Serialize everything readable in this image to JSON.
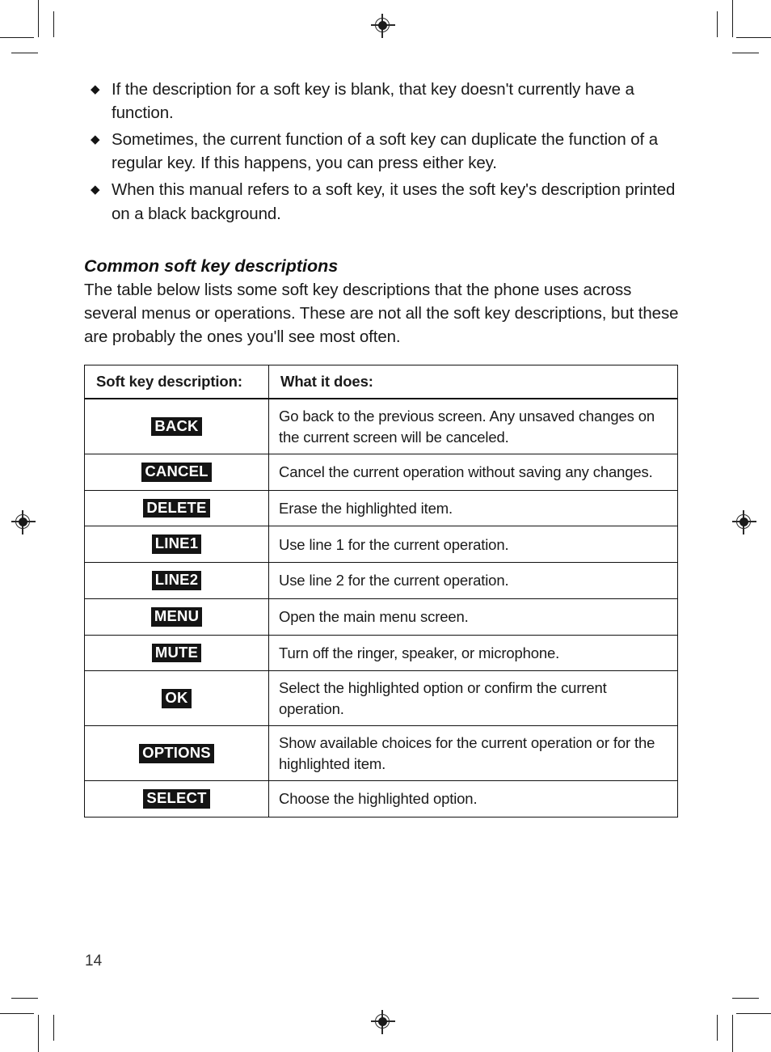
{
  "page": {
    "number": "14"
  },
  "notes": {
    "bullet_glyph": "◆",
    "items": [
      "If the description for a soft key is blank, that key doesn't currently have a function.",
      "Sometimes, the current function of a soft key can duplicate the function of a regular key. If this happens, you can press either key.",
      "When this manual refers to a soft key, it uses the soft key's description printed on a black background."
    ]
  },
  "section": {
    "title": "Common soft key descriptions",
    "intro": "The table below lists some soft key descriptions that the phone uses across several menus or operations. These are not all the soft key descriptions, but these are probably the ones you'll see most often."
  },
  "table": {
    "headers": [
      "Soft key description:",
      "What it does:"
    ],
    "rows": [
      {
        "key": "BACK",
        "desc": "Go back to the previous screen. Any unsaved changes on the current screen will be canceled."
      },
      {
        "key": "CANCEL",
        "desc": "Cancel the current operation without saving any changes."
      },
      {
        "key": "DELETE",
        "desc": "Erase the highlighted item."
      },
      {
        "key": "LINE1",
        "desc": "Use line 1 for the current operation."
      },
      {
        "key": "LINE2",
        "desc": "Use line 2 for the current operation."
      },
      {
        "key": "MENU",
        "desc": "Open the main menu screen."
      },
      {
        "key": "MUTE",
        "desc": "Turn off the ringer, speaker, or microphone."
      },
      {
        "key": "OK",
        "desc": "Select the highlighted option or confirm the current operation."
      },
      {
        "key": "OPTIONS",
        "desc": "Show available choices for the current operation or for the highlighted item."
      },
      {
        "key": "SELECT",
        "desc": "Choose the highlighted option."
      }
    ]
  },
  "colors": {
    "text": "#1a1a1a",
    "badge_background": "#141414",
    "badge_text": "#ffffff",
    "rule": "#111111"
  }
}
